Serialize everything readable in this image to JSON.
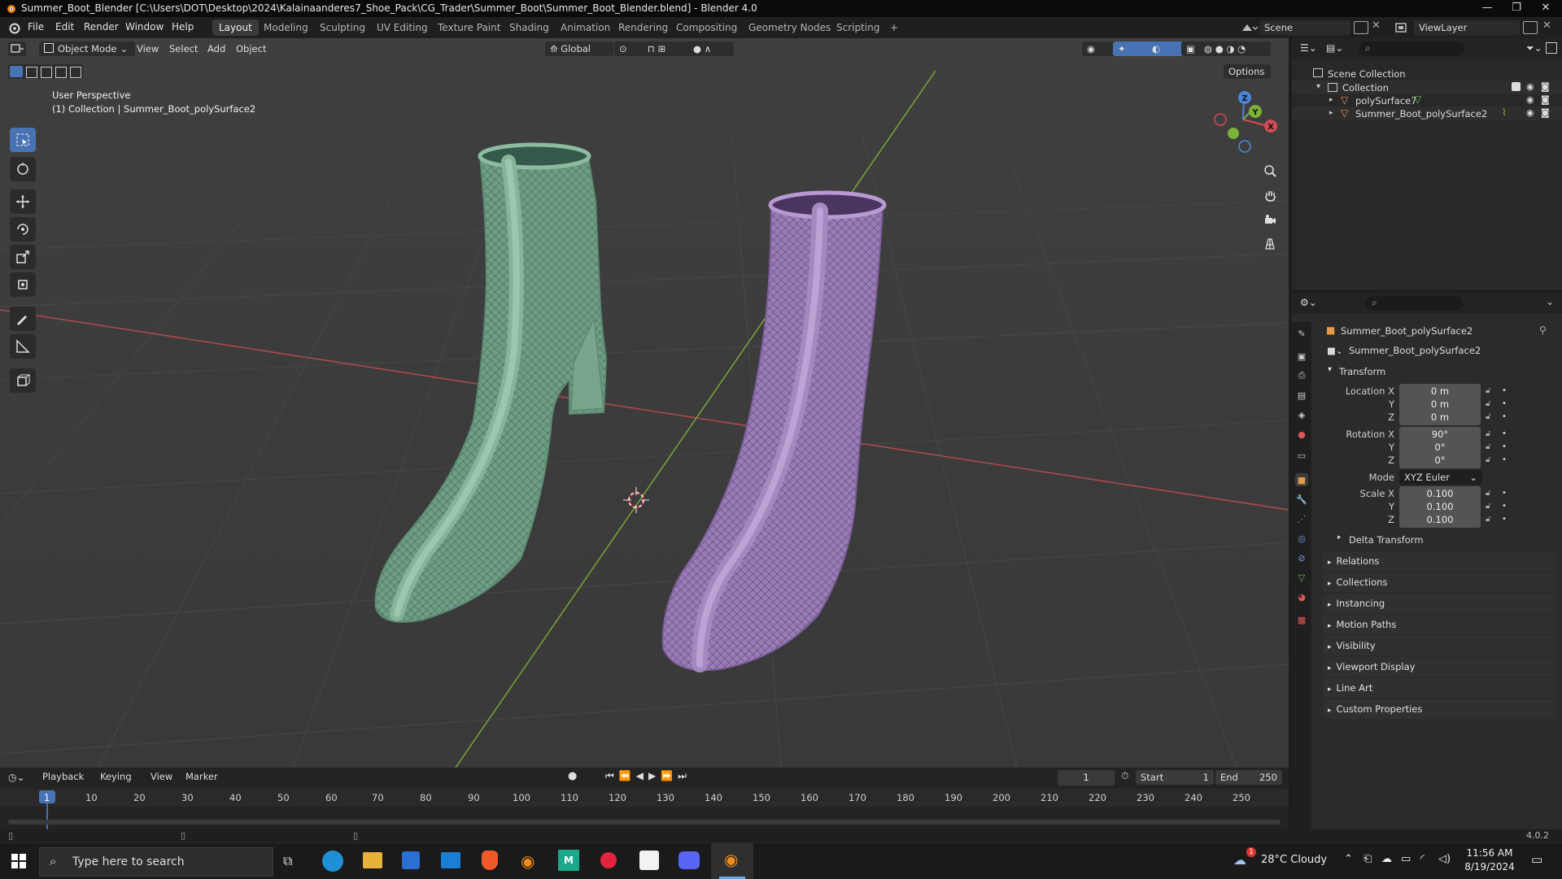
{
  "window": {
    "title": "Summer_Boot_Blender [C:\\Users\\DOT\\Desktop\\2024\\Kalainaanderes7_Shoe_Pack\\CG_Trader\\Summer_Boot\\Summer_Boot_Blender.blend] - Blender 4.0",
    "controls": [
      "—",
      "❐",
      "✕"
    ]
  },
  "menus": [
    "File",
    "Edit",
    "Render",
    "Window",
    "Help"
  ],
  "workspaces": [
    {
      "label": "Layout",
      "active": true
    },
    {
      "label": "Modeling"
    },
    {
      "label": "Sculpting"
    },
    {
      "label": "UV Editing"
    },
    {
      "label": "Texture Paint"
    },
    {
      "label": "Shading"
    },
    {
      "label": "Animation"
    },
    {
      "label": "Rendering"
    },
    {
      "label": "Compositing"
    },
    {
      "label": "Geometry Nodes"
    },
    {
      "label": "Scripting"
    }
  ],
  "add_workspace": "+",
  "scene": {
    "name": "Scene",
    "view_layer": "ViewLayer"
  },
  "viewport": {
    "mode": "Object Mode",
    "menus": [
      "View",
      "Select",
      "Add",
      "Object"
    ],
    "orientation": "Global",
    "options_label": "Options",
    "overlay_line1": "User Perspective",
    "overlay_line2": "(1) Collection | Summer_Boot_polySurface2",
    "gizmo": {
      "x": "X",
      "y": "Y",
      "z": "Z"
    }
  },
  "outliner": {
    "root": "Scene Collection",
    "collection": "Collection",
    "items": [
      "polySurface7",
      "Summer_Boot_polySurface2"
    ]
  },
  "properties": {
    "object_name": "Summer_Boot_polySurface2",
    "datablock_name": "Summer_Boot_polySurface2",
    "transform_label": "Transform",
    "location": {
      "label_x": "Location X",
      "label_y": "Y",
      "label_z": "Z",
      "x": "0 m",
      "y": "0 m",
      "z": "0 m"
    },
    "rotation": {
      "label_x": "Rotation X",
      "label_y": "Y",
      "label_z": "Z",
      "x": "90°",
      "y": "0°",
      "z": "0°"
    },
    "mode_label": "Mode",
    "mode_value": "XYZ Euler",
    "scale": {
      "label_x": "Scale X",
      "label_y": "Y",
      "label_z": "Z",
      "x": "0.100",
      "y": "0.100",
      "z": "0.100"
    },
    "delta_transform": "Delta Transform",
    "panels": [
      "Relations",
      "Collections",
      "Instancing",
      "Motion Paths",
      "Visibility",
      "Viewport Display",
      "Line Art",
      "Custom Properties"
    ]
  },
  "timeline": {
    "menus": [
      "Playback",
      "Keying",
      "View",
      "Marker"
    ],
    "current_frame": "1",
    "start_label": "Start",
    "start": "1",
    "end_label": "End",
    "end": "250",
    "ticks": [
      "1",
      "10",
      "20",
      "30",
      "40",
      "50",
      "60",
      "70",
      "80",
      "90",
      "100",
      "110",
      "120",
      "130",
      "140",
      "150",
      "160",
      "170",
      "180",
      "190",
      "200",
      "210",
      "220",
      "230",
      "240",
      "250"
    ]
  },
  "status": {
    "version": "4.0.2"
  },
  "taskbar": {
    "search_placeholder": "Type here to search",
    "weather": "28°C  Cloudy",
    "time": "11:56 AM",
    "date": "8/19/2024",
    "notification_count": "1"
  },
  "colors": {
    "accent": "#4772b3",
    "boot_left": "#7fae94",
    "boot_right": "#a88ac4",
    "axis_red": "#c0454a",
    "axis_green": "#7cae3a",
    "viewport_bg": "#3d3d3d"
  }
}
